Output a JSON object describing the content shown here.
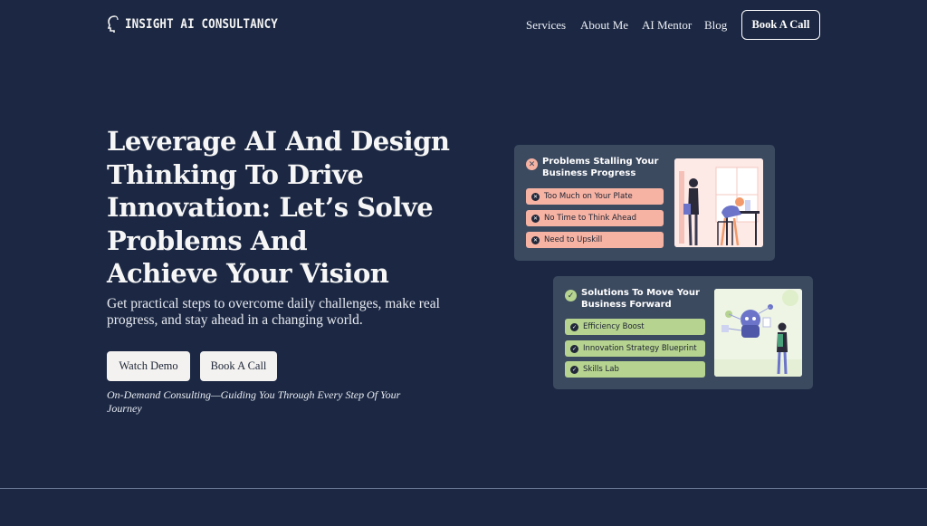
{
  "header": {
    "logo_text": "INSIGHT AI CONSULTANCY",
    "nav": [
      {
        "label": "Services"
      },
      {
        "label": "About Me"
      },
      {
        "label": "AI Mentor"
      },
      {
        "label": "Blog"
      }
    ],
    "cta_label": "Book A Call"
  },
  "hero": {
    "title_lines": [
      "Leverage AI And Design",
      "Thinking To Drive",
      "Innovation: Let’s Solve",
      "Problems And",
      "Achieve Your Vision"
    ],
    "subtitle": "Get practical steps to overcome daily challenges, make real progress, and stay ahead in a changing world.",
    "buttons": [
      {
        "label": "Watch Demo"
      },
      {
        "label": "Book A Call"
      }
    ],
    "tagline": "On-Demand Consulting—Guiding You Through Every Step Of Your Journey"
  },
  "problems_card": {
    "title": "Problems Stalling Your Business Progress",
    "icon": "x-circle-icon",
    "items": [
      "Too Much on Your Plate",
      "No Time to Think Ahead",
      "Need to Upskill"
    ]
  },
  "solutions_card": {
    "title": "Solutions To Move Your Business Forward",
    "icon": "check-circle-icon",
    "items": [
      "Efficiency Boost",
      "Innovation Strategy Blueprint",
      "Skills Lab"
    ]
  },
  "colors": {
    "background": "#1c2843",
    "card": "#3c4a60",
    "problem_pill": "#f6b3a3",
    "solution_pill": "#b6d38f"
  }
}
